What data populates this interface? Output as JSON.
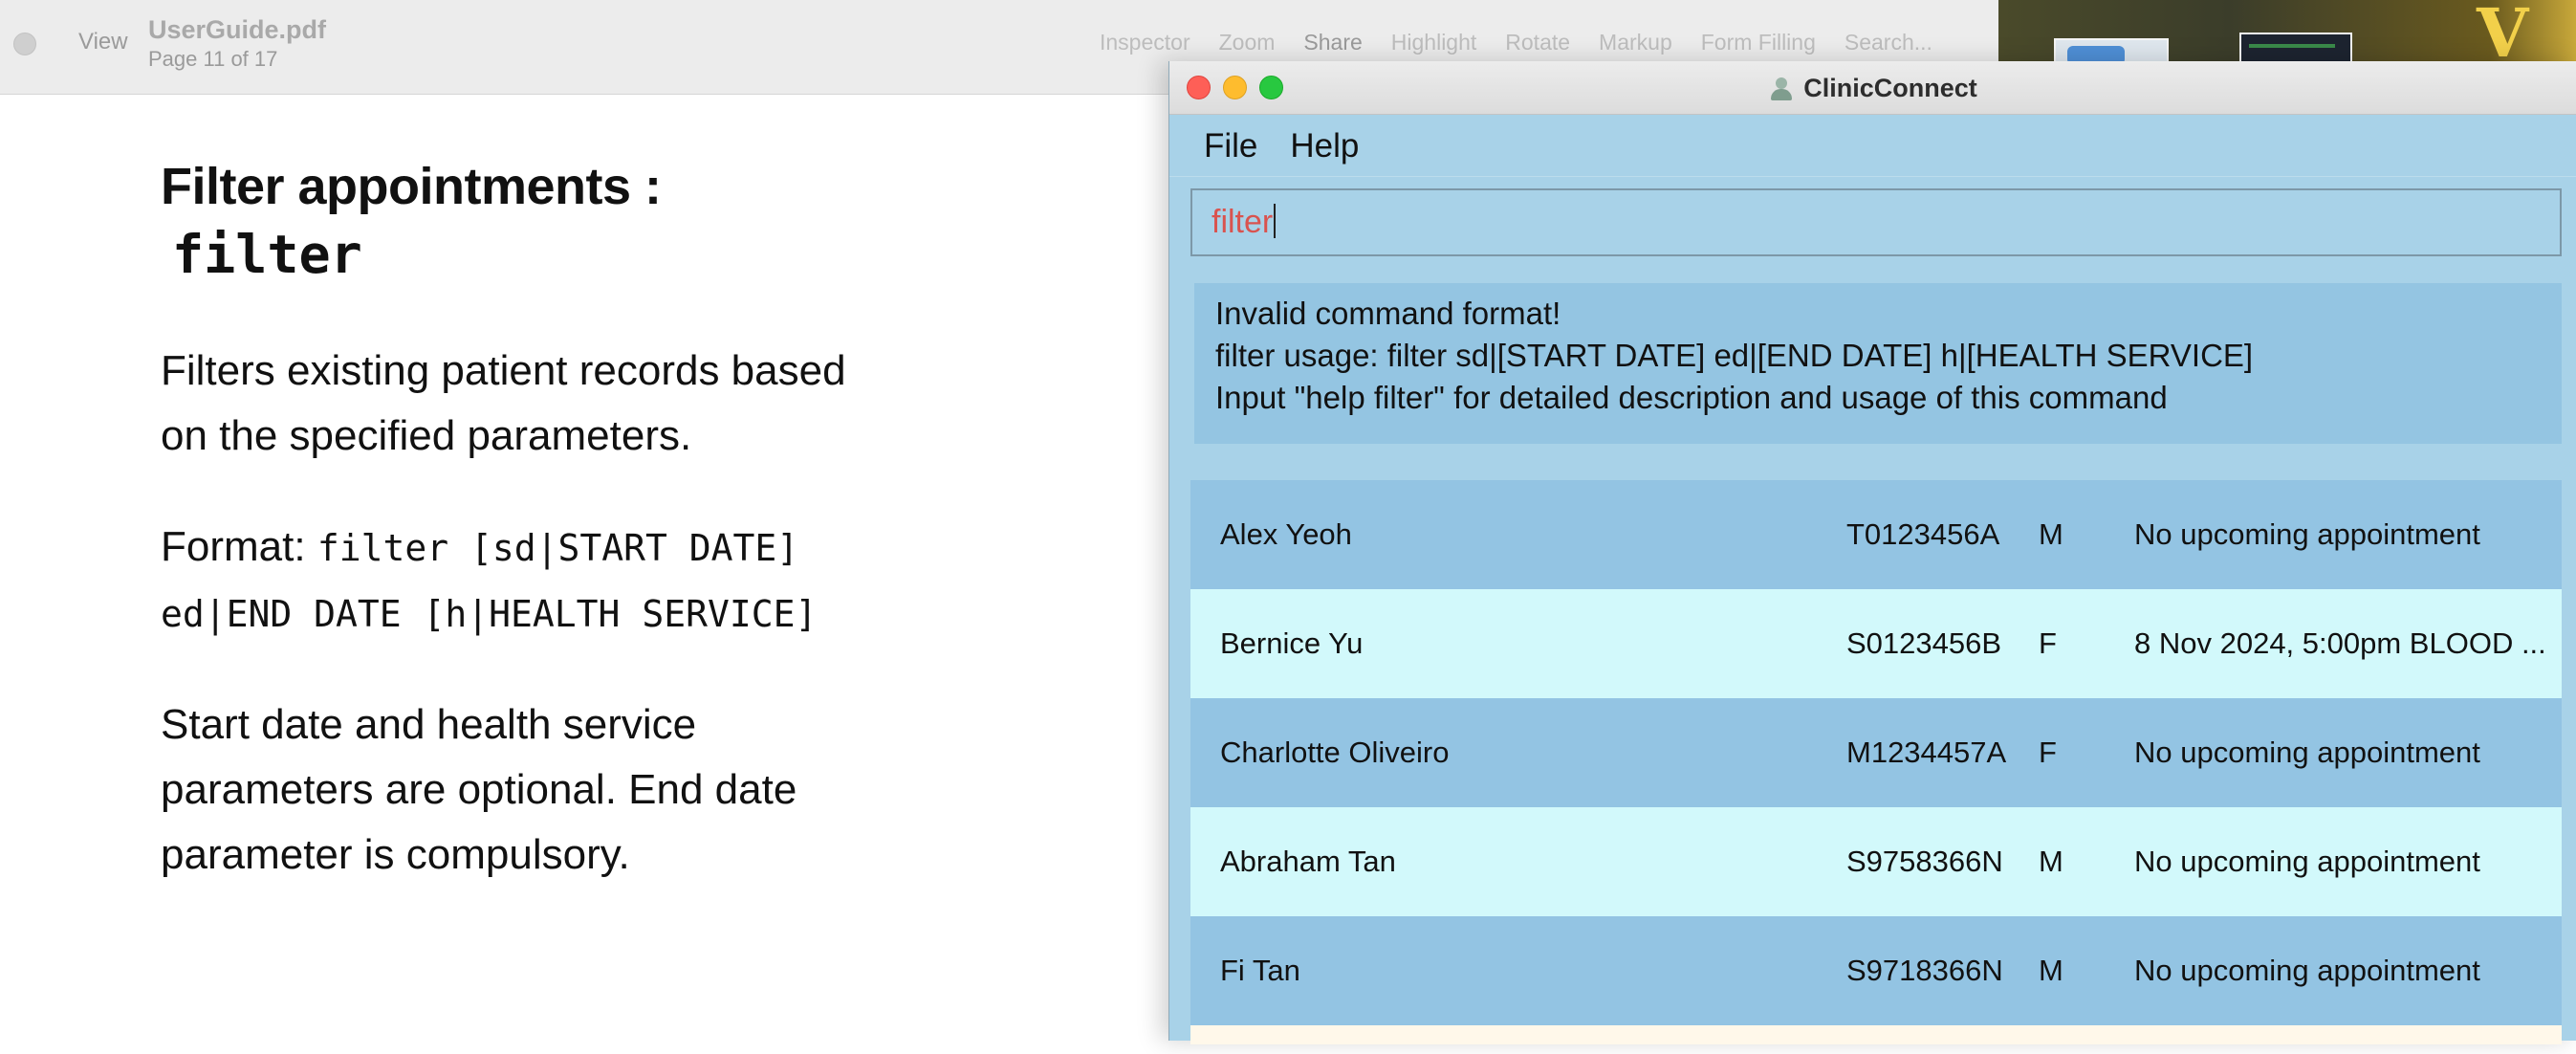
{
  "preview": {
    "view_label": "View",
    "file_title": "UserGuide.pdf",
    "page_indicator": "Page 11 of 17",
    "toolbar": {
      "inspector": "Inspector",
      "zoom": "Zoom",
      "share": "Share",
      "highlight": "Highlight",
      "rotate": "Rotate",
      "markup": "Markup",
      "form_filling": "Form Filling",
      "search": "Search..."
    },
    "document": {
      "heading": "Filter appointments :",
      "heading_code": "filter",
      "paragraph1": "Filters existing patient records based on the specified parameters.",
      "format_label": "Format:",
      "format_code": "filter [sd|START DATE] ed|END DATE [h|HEALTH SERVICE]",
      "paragraph3": "Start date and health service parameters are optional. End date parameter is compulsory."
    }
  },
  "app": {
    "title": "ClinicConnect",
    "menu": [
      "File",
      "Help"
    ],
    "command_input": "filter",
    "result": [
      "Invalid command format!",
      "filter usage: filter sd|[START DATE] ed|[END DATE] h|[HEALTH SERVICE]",
      "Input \"help filter\" for detailed description and usage of this command"
    ],
    "patients": [
      {
        "name": "Alex Yeoh",
        "nric": "T0123456A",
        "sex": "M",
        "appointment": "No upcoming appointment"
      },
      {
        "name": "Bernice Yu",
        "nric": "S0123456B",
        "sex": "F",
        "appointment": "8 Nov 2024, 5:00pm  BLOOD ..."
      },
      {
        "name": "Charlotte Oliveiro",
        "nric": "M1234457A",
        "sex": "F",
        "appointment": "No upcoming appointment"
      },
      {
        "name": "Abraham Tan",
        "nric": "S9758366N",
        "sex": "M",
        "appointment": "No upcoming appointment"
      },
      {
        "name": "Fi Tan",
        "nric": "S9718366N",
        "sex": "M",
        "appointment": "No upcoming appointment"
      }
    ]
  },
  "colors": {
    "app_background": "#a8d2e8",
    "row_dark": "#93c4e3",
    "row_light": "#d2f9fb",
    "command_text": "#d9534f"
  },
  "icons": [
    "window-close-icon",
    "window-minimize-icon",
    "window-zoom-icon",
    "clinicconnect-app-icon"
  ]
}
